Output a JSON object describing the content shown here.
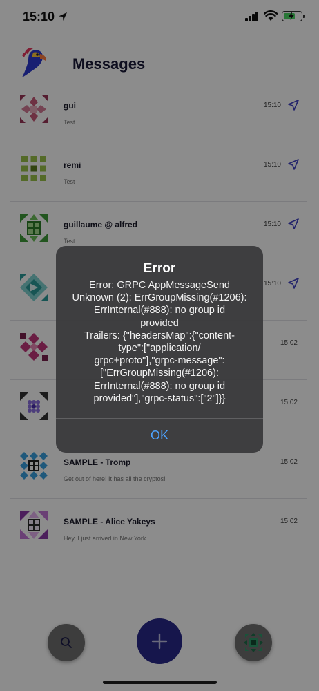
{
  "status_bar": {
    "time": "15:10"
  },
  "header": {
    "title": "Messages"
  },
  "conversations": [
    {
      "name": "gui",
      "message": "Test",
      "time": "15:10",
      "sent": true
    },
    {
      "name": "remi",
      "message": "Test",
      "time": "15:10",
      "sent": true
    },
    {
      "name": "guillaume @ alfred",
      "message": "Test",
      "time": "15:10",
      "sent": true
    },
    {
      "name": "",
      "message": "",
      "time": "15:10",
      "sent": true
    },
    {
      "name": "",
      "message": "",
      "time": "15:02",
      "sent": false
    },
    {
      "name": "",
      "message": "",
      "time": "15:02",
      "sent": false
    },
    {
      "name": "SAMPLE - Tromp",
      "message": "Get out of here! It has all the cryptos!",
      "time": "15:02",
      "sent": false
    },
    {
      "name": "SAMPLE - Alice Yakeys",
      "message": "Hey, I just arrived in New York",
      "time": "15:02",
      "sent": false
    }
  ],
  "alert": {
    "title": "Error",
    "message": "Error: GRPC AppMessageSend\nUnknown (2): ErrGroupMissing(#1206):\nErrInternal(#888): no group id\nprovided\nTrailers: {\"headersMap\":{\"content-\ntype\":[\"application/\ngrpc+proto\"],\"grpc-message\":\n[\"ErrGroupMissing(#1206):\nErrInternal(#888): no group id\nprovided\"],\"grpc-status\":[\"2\"]}}",
    "ok_label": "OK"
  },
  "icons": {
    "status": [
      "location-arrow-icon",
      "cellular-signal-icon",
      "wifi-icon",
      "battery-charging-icon"
    ],
    "nav": [
      "search-icon",
      "plus-icon",
      "account-avatar-icon"
    ],
    "message_state": "send-arrow-icon"
  },
  "colors": {
    "accent": "#3f41c4",
    "alert_button": "#4da3ff",
    "battery": "#4cd964"
  }
}
